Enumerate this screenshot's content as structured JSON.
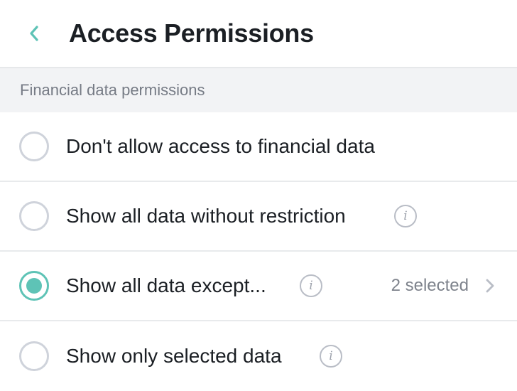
{
  "header": {
    "back_icon": "chevron-left-icon",
    "title": "Access Permissions"
  },
  "section": {
    "heading": "Financial data permissions"
  },
  "options": [
    {
      "label": "Don't allow access to financial data",
      "selected": false,
      "has_info": false
    },
    {
      "label": "Show all data without restriction",
      "selected": false,
      "has_info": true
    },
    {
      "label": "Show all data except...",
      "selected": true,
      "has_info": true,
      "meta": "2 selected",
      "has_chevron": true
    },
    {
      "label": "Show only selected data",
      "selected": false,
      "has_info": true
    }
  ],
  "info_glyph": "i",
  "colors": {
    "accent": "#5ec3b6",
    "radio_border": "#cfd3db",
    "section_bg": "#f2f3f5",
    "text": "#1b1f24",
    "muted": "#7e838c"
  }
}
